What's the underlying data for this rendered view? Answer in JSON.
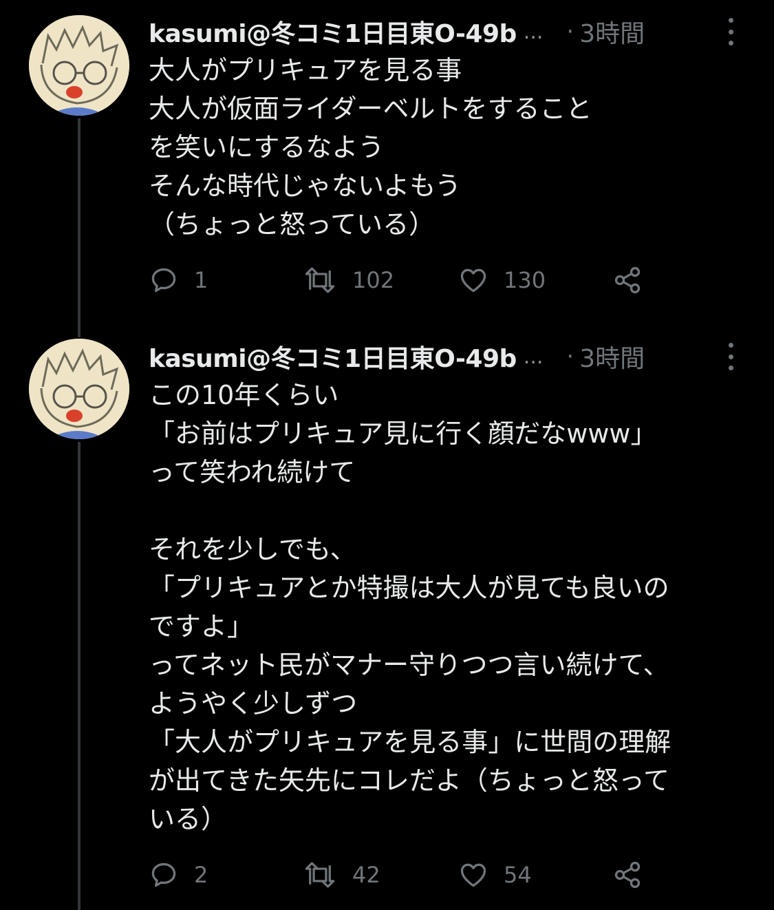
{
  "tweets": [
    {
      "author": "kasumi@冬コミ1日目東O-49b",
      "ellipsis": "...",
      "dot": "·",
      "time": "3時間",
      "text": "大人がプリキュアを見る事\n大人が仮面ライダーベルトをすること\nを笑いにするなよう\nそんな時代じゃないよもう\n（ちょっと怒っている）",
      "reply_count": "1",
      "retweet_count": "102",
      "like_count": "130"
    },
    {
      "author": "kasumi@冬コミ1日目東O-49b",
      "ellipsis": "...",
      "dot": "·",
      "time": "3時間",
      "text": "この10年くらい\n「お前はプリキュア見に行く顔だなwww」\nって笑われ続けて\n\nそれを少しでも、\n「プリキュアとか特撮は大人が見ても良いの\nですよ」\nってネット民がマナー守りつつ言い続けて、\nようやく少しずつ\n「大人がプリキュアを見る事」に世間の理解\nが出てきた矢先にコレだよ（ちょっと怒って\nいる）",
      "reply_count": "2",
      "retweet_count": "42",
      "like_count": "54"
    }
  ],
  "icons": {
    "reply": "speech-bubble-icon",
    "retweet": "retweet-arrows-icon",
    "like": "heart-icon",
    "share": "share-icon",
    "more": "vertical-dots-icon"
  },
  "colors": {
    "background": "#000000",
    "text": "#e7e9ea",
    "muted": "#71767b",
    "thread_line": "#333639"
  }
}
